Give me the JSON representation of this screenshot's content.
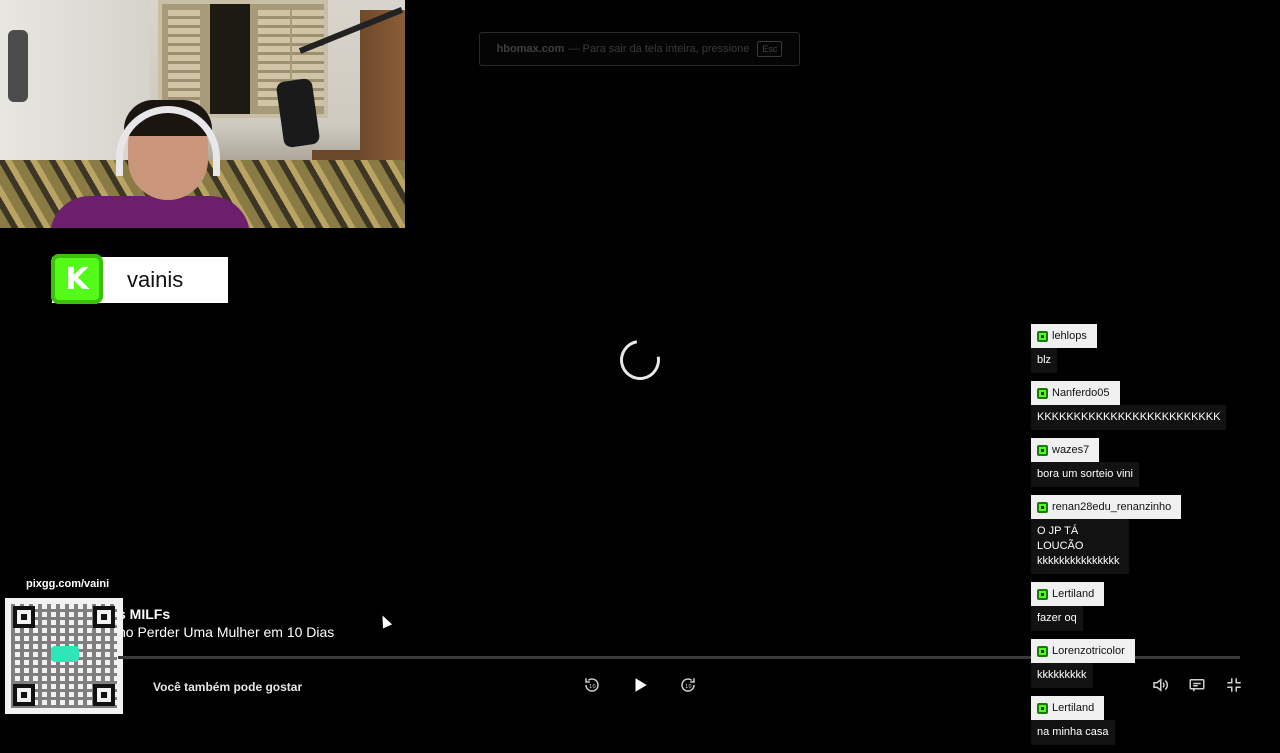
{
  "streamer": {
    "name": "vainis",
    "logo_letter": "K"
  },
  "fullscreen_notice": {
    "site": "hbomax.com",
    "text": "— Para sair da tela inteira, pressione",
    "key": "Esc"
  },
  "player": {
    "show_title": "s MILFs",
    "episode_title": "no Perder Uma Mulher em 10 Dias",
    "progress": 0.0,
    "suggest_label": "Você também pode gostar",
    "loading": true
  },
  "qr": {
    "label": "pixgg.com/vaini"
  },
  "controls": {
    "rewind_icon": "rewind-10-icon",
    "play_icon": "play-icon",
    "forward_icon": "forward-10-icon",
    "volume_icon": "volume-icon",
    "subtitles_icon": "subtitles-icon",
    "exit_fullscreen_icon": "exit-fullscreen-icon"
  },
  "chat": {
    "messages": [
      {
        "user": "lehlops",
        "text": "blz"
      },
      {
        "user": "Nanferdo05",
        "text": "KKKKKKKKKKKKKKKKKKKKKKKKK"
      },
      {
        "user": "wazes7",
        "text": "bora um sorteio vini"
      },
      {
        "user": "renan28edu_renanzinho",
        "text": "O JP TÁ LOUCÃO kkkkkkkkkkkkkkk"
      },
      {
        "user": "Lertiland",
        "text": "fazer oq"
      },
      {
        "user": "Lorenzotricolor",
        "text": "kkkkkkkkk"
      },
      {
        "user": "Lertiland",
        "text": "na minha casa"
      }
    ]
  },
  "colors": {
    "kick_green": "#53fc18",
    "background": "#000000"
  }
}
